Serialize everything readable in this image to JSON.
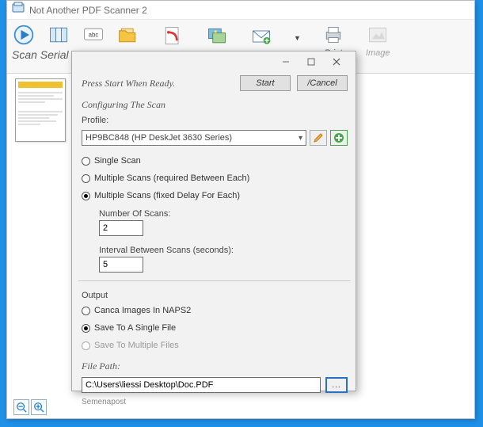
{
  "window": {
    "title": "Not Another PDF Scanner 2"
  },
  "toolbar": {
    "scan_group": "Scan Serial Scan",
    "print": "Print",
    "image": "Image"
  },
  "dialog": {
    "prompt": "Press Start When Ready.",
    "start": "Start",
    "cancel": "/Cancel",
    "config_title": "Configuring The Scan",
    "profile_label": "Profile:",
    "profile_value": "HP9BC848 (HP DeskJet 3630 Series)",
    "radio_single": "Single Scan",
    "radio_multi_req": "Multiple Scans (required Between Each)",
    "radio_multi_fixed": "Multiple Scans (fixed Delay For Each)",
    "num_scans_label": "Number Of Scans:",
    "num_scans_value": "2",
    "interval_label": "Interval Between Scans (seconds):",
    "interval_value": "5",
    "output_title": "Output",
    "out_cancel": "Canca Images In NAPS2",
    "out_single": "Save To A Single File",
    "out_multi": "Save To Multiple Files",
    "filepath_label": "File Path:",
    "filepath_value": "C:\\Users\\liessi Desktop\\Doc.PDF",
    "browse": "...",
    "footnote": "Semenapost"
  }
}
